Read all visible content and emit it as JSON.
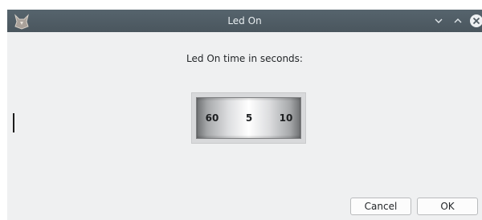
{
  "window": {
    "title": "Led On",
    "titlebar_color": "#4f5b63",
    "controls": [
      "chevron-down-icon",
      "chevron-up-icon",
      "close-icon"
    ]
  },
  "dialog": {
    "prompt": "Led On time in seconds:",
    "drum_values": [
      "60",
      "5",
      "10"
    ],
    "buttons": {
      "cancel": "Cancel",
      "ok": "OK"
    }
  }
}
